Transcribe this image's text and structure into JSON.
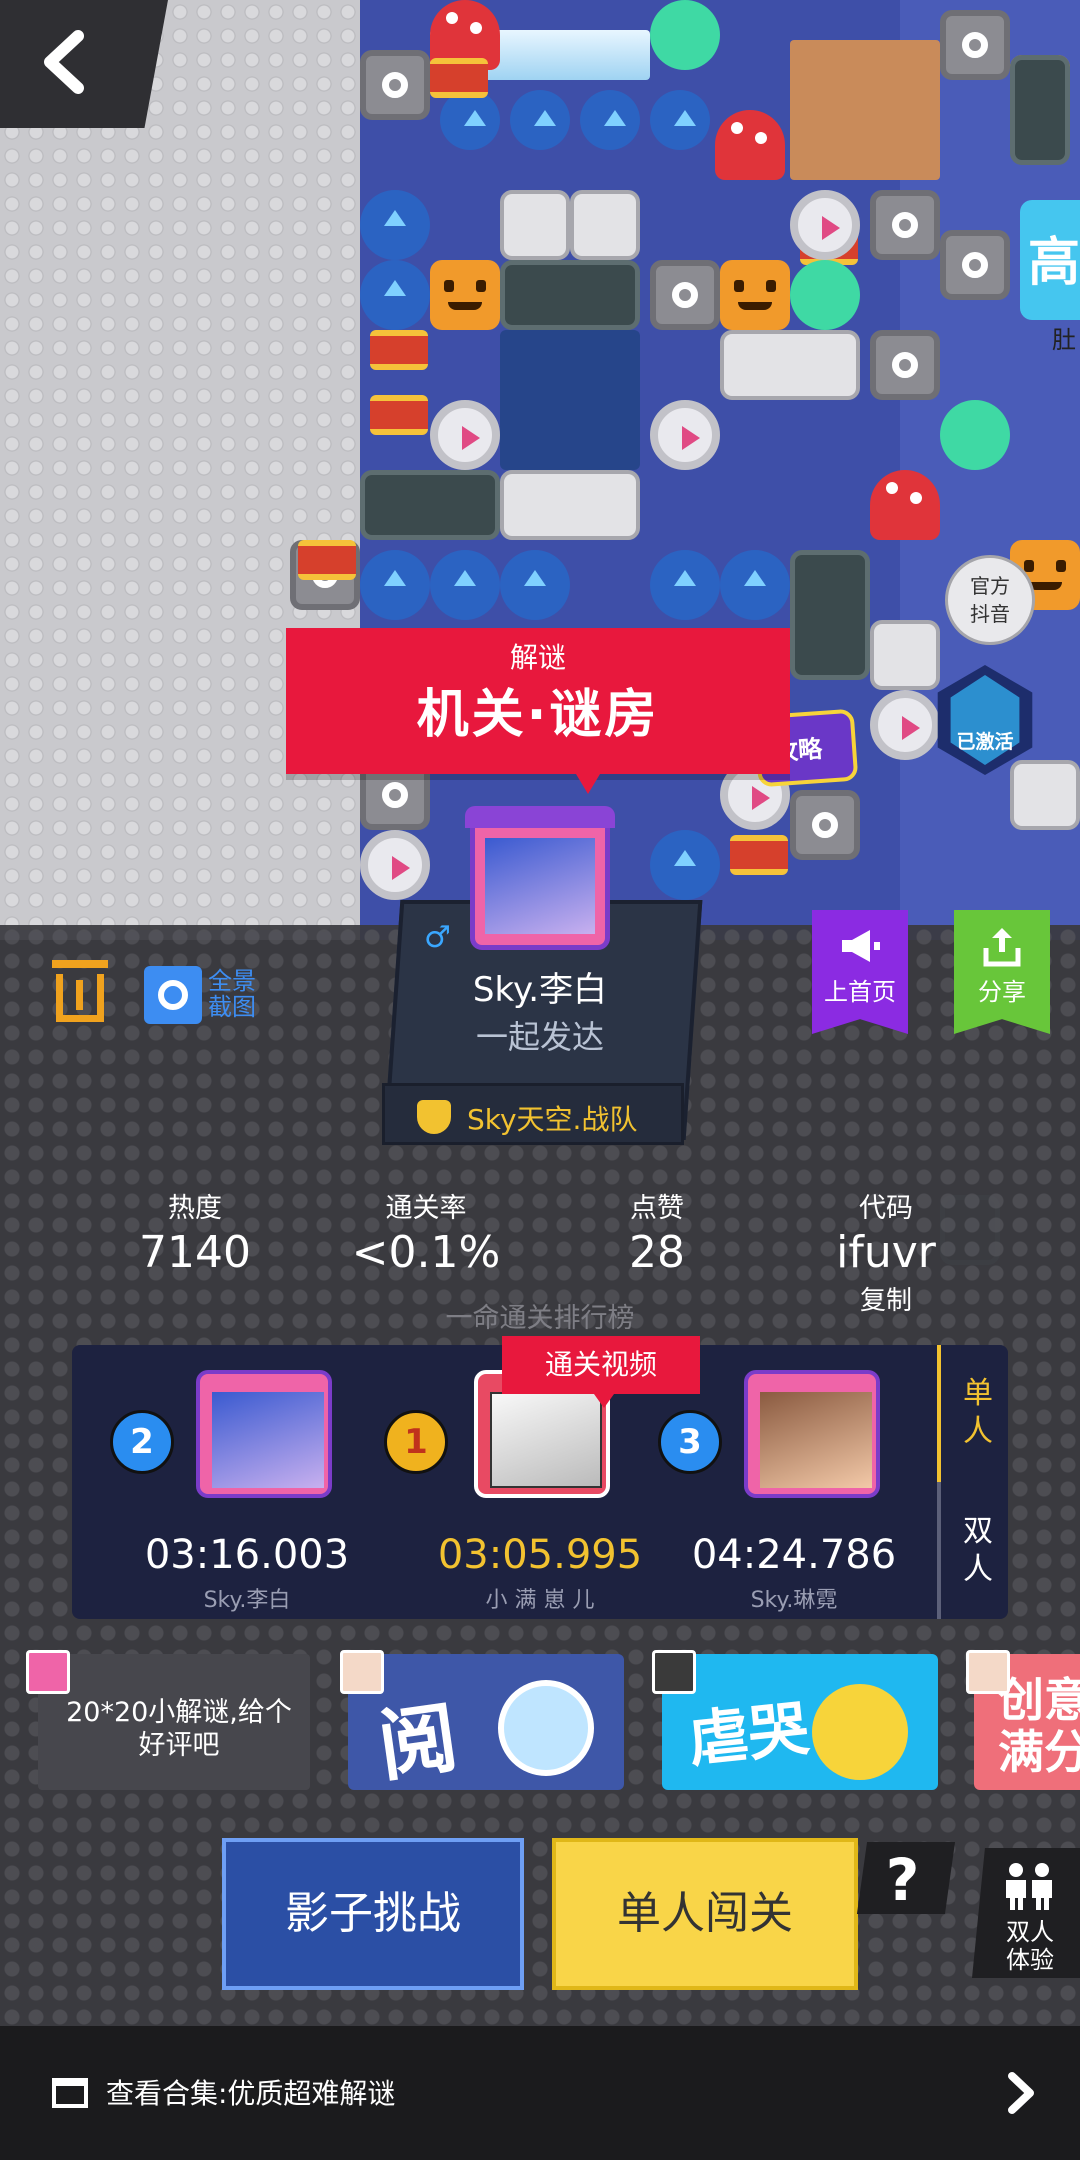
{
  "level": {
    "category": "解谜",
    "title": "机关·谜房",
    "guide_label": "攻略"
  },
  "badges": {
    "official_line1": "官方",
    "official_line2": "抖音",
    "activated": "已激活",
    "right_tag": "高",
    "right_sub": "肚"
  },
  "author": {
    "gender_symbol": "♂",
    "name": "Sky.李白",
    "motto": "一起发达",
    "team": "Sky天空.战队"
  },
  "actions": {
    "screenshot_label": "全景截图",
    "promote_label": "上首页",
    "share_label": "分享"
  },
  "stats": {
    "heat_label": "热度",
    "heat_value": "7140",
    "pass_rate_label": "通关率",
    "pass_rate_value": "<0.1%",
    "likes_label": "点赞",
    "likes_value": "28",
    "code_label": "代码",
    "code_value": "ifuvr",
    "copy_label": "复制"
  },
  "leaderboard": {
    "title": "一命通关排行榜",
    "video_tag": "通关视频",
    "mode_single": "单人",
    "mode_double": "双人",
    "entries": [
      {
        "rank": "2",
        "time": "03:16.003",
        "name": "Sky.李白"
      },
      {
        "rank": "1",
        "time": "03:05.995",
        "name": "小 满 崽 儿"
      },
      {
        "rank": "3",
        "time": "04:24.786",
        "name": "Sky.琳霓"
      }
    ]
  },
  "cards": {
    "description": "20*20小解谜,给个好评吧",
    "card1_text": "阅",
    "card2_text": "虐哭",
    "card3_text": "创意满分"
  },
  "buttons": {
    "shadow": "影子挑战",
    "solo": "单人闯关",
    "help": "?",
    "duo": "双人体验"
  },
  "footer": {
    "collection": "查看合集:优质超难解谜"
  },
  "colors": {
    "title_red": "#e8183d",
    "gold": "#f2c230",
    "shadow_blue": "#2b4fa5",
    "solo_yellow": "#f9d548",
    "promote_purple": "#8b2be2",
    "share_green": "#68c63a"
  }
}
